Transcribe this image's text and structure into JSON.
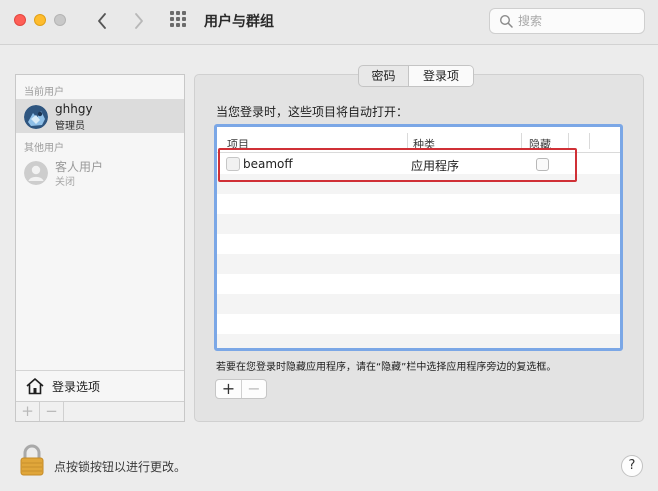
{
  "window": {
    "title": "用户与群组",
    "search_placeholder": "搜索"
  },
  "sidebar": {
    "current_user_header": "当前用户",
    "current_user": {
      "name": "ghhgy",
      "role": "管理员"
    },
    "other_users_header": "其他用户",
    "guest_user": {
      "name": "客人用户",
      "role": "关闭"
    },
    "login_options_label": "登录选项",
    "add_label": "+",
    "remove_label": "−"
  },
  "tabs": [
    {
      "label": "密码",
      "selected": false
    },
    {
      "label": "登录项",
      "selected": true
    }
  ],
  "login_items": {
    "intro": "当您登录时，这些项目将自动打开：",
    "columns": {
      "item": "项目",
      "kind": "种类",
      "hide": "隐藏"
    },
    "rows": [
      {
        "item": "beamoff",
        "kind": "应用程序",
        "hidden": false
      }
    ],
    "hint": "若要在您登录时隐藏应用程序，请在“隐藏”栏中选择应用程序旁边的复选框。",
    "add_label": "+",
    "remove_label": "−"
  },
  "footer": {
    "lock_text": "点按锁按钮以进行更改。",
    "help_label": "?"
  },
  "colors": {
    "close": "#fe5f57",
    "minimize": "#febc2e",
    "table_focus": "#7ba7e6",
    "highlight": "#d03036"
  }
}
